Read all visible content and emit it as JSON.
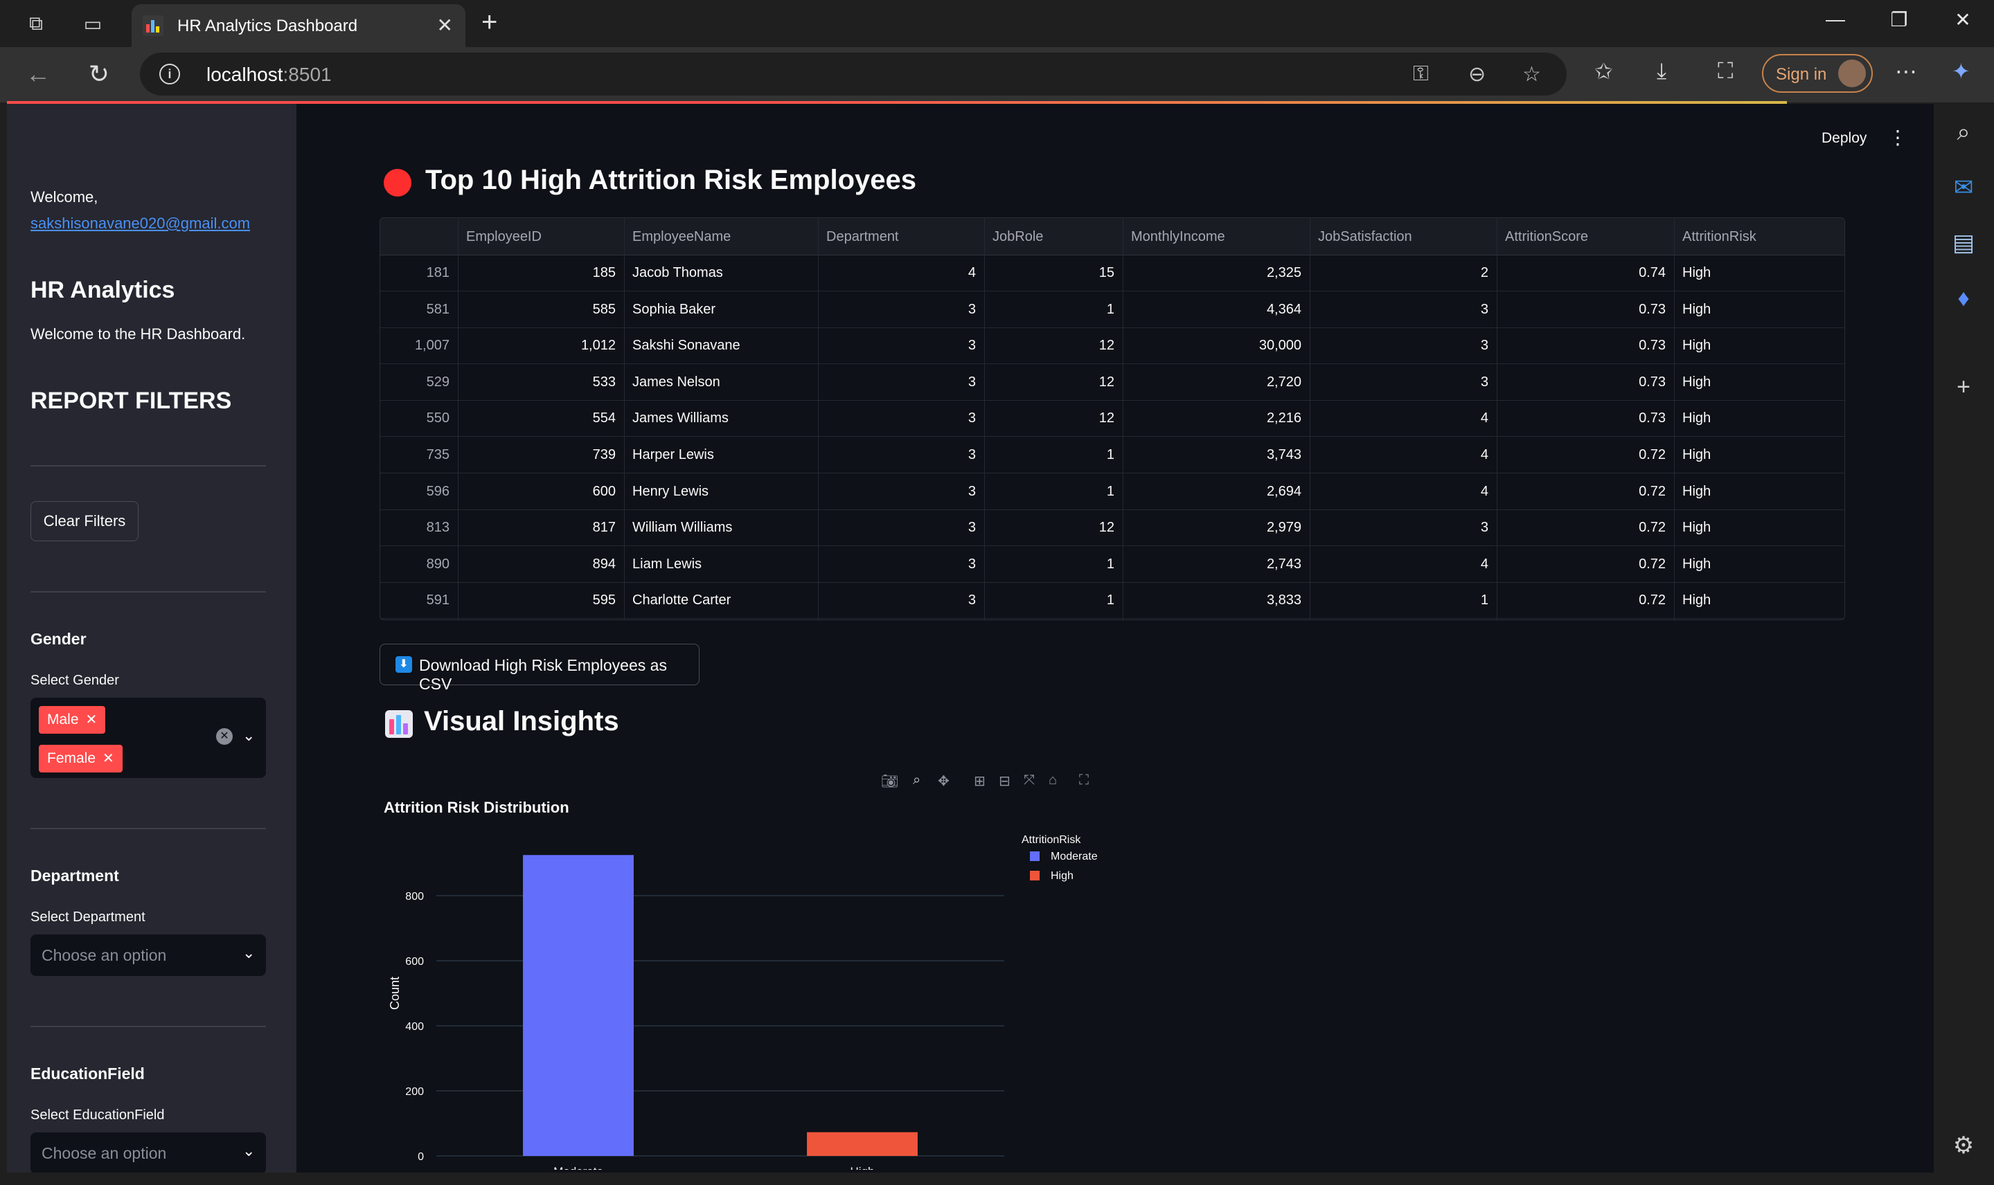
{
  "browser": {
    "tab_title": "HR Analytics Dashboard",
    "url_host": "localhost",
    "url_port": ":8501",
    "signin_label": "Sign in"
  },
  "app": {
    "deploy_label": "Deploy"
  },
  "sidebar": {
    "welcome": "Welcome,",
    "email": "sakshisonavane020@gmail.com",
    "title": "HR Analytics",
    "subtitle": "Welcome to the HR Dashboard.",
    "filters_heading": "REPORT FILTERS",
    "clear_filters": "Clear Filters",
    "gender": {
      "heading": "Gender",
      "label": "Select Gender",
      "selected": [
        "Male",
        "Female"
      ]
    },
    "department": {
      "heading": "Department",
      "label": "Select Department",
      "placeholder": "Choose an option"
    },
    "education": {
      "heading": "EducationField",
      "label": "Select EducationField",
      "placeholder": "Choose an option"
    }
  },
  "main": {
    "risk_heading": "Top 10 High Attrition Risk Employees",
    "download_label": "Download High Risk Employees as CSV",
    "insights_heading": "Visual Insights",
    "table": {
      "columns": [
        "",
        "EmployeeID",
        "EmployeeName",
        "Department",
        "JobRole",
        "MonthlyIncome",
        "JobSatisfaction",
        "AttritionScore",
        "AttritionRisk"
      ],
      "rows": [
        [
          "181",
          "185",
          "Jacob Thomas",
          "4",
          "15",
          "2,325",
          "2",
          "0.74",
          "High"
        ],
        [
          "581",
          "585",
          "Sophia Baker",
          "3",
          "1",
          "4,364",
          "3",
          "0.73",
          "High"
        ],
        [
          "1,007",
          "1,012",
          "Sakshi Sonavane",
          "3",
          "12",
          "30,000",
          "3",
          "0.73",
          "High"
        ],
        [
          "529",
          "533",
          "James Nelson",
          "3",
          "12",
          "2,720",
          "3",
          "0.73",
          "High"
        ],
        [
          "550",
          "554",
          "James Williams",
          "3",
          "12",
          "2,216",
          "4",
          "0.73",
          "High"
        ],
        [
          "735",
          "739",
          "Harper Lewis",
          "3",
          "1",
          "3,743",
          "4",
          "0.72",
          "High"
        ],
        [
          "596",
          "600",
          "Henry Lewis",
          "3",
          "1",
          "2,694",
          "4",
          "0.72",
          "High"
        ],
        [
          "813",
          "817",
          "William Williams",
          "3",
          "12",
          "2,979",
          "3",
          "0.72",
          "High"
        ],
        [
          "890",
          "894",
          "Liam Lewis",
          "3",
          "1",
          "2,743",
          "4",
          "0.72",
          "High"
        ],
        [
          "591",
          "595",
          "Charlotte Carter",
          "3",
          "1",
          "3,833",
          "1",
          "0.72",
          "High"
        ]
      ]
    }
  },
  "chart_data": {
    "type": "bar",
    "title": "Attrition Risk Distribution",
    "xlabel": "",
    "ylabel": "Count",
    "categories": [
      "Moderate",
      "High"
    ],
    "values": [
      925,
      73
    ],
    "colors": [
      "#636efa",
      "#ef553b"
    ],
    "ylim": [
      0,
      1000
    ],
    "yticks": [
      0,
      200,
      400,
      600,
      800
    ],
    "legend_title": "AttritionRisk",
    "legend": [
      "Moderate",
      "High"
    ],
    "legend_position": "right",
    "grid": true
  }
}
